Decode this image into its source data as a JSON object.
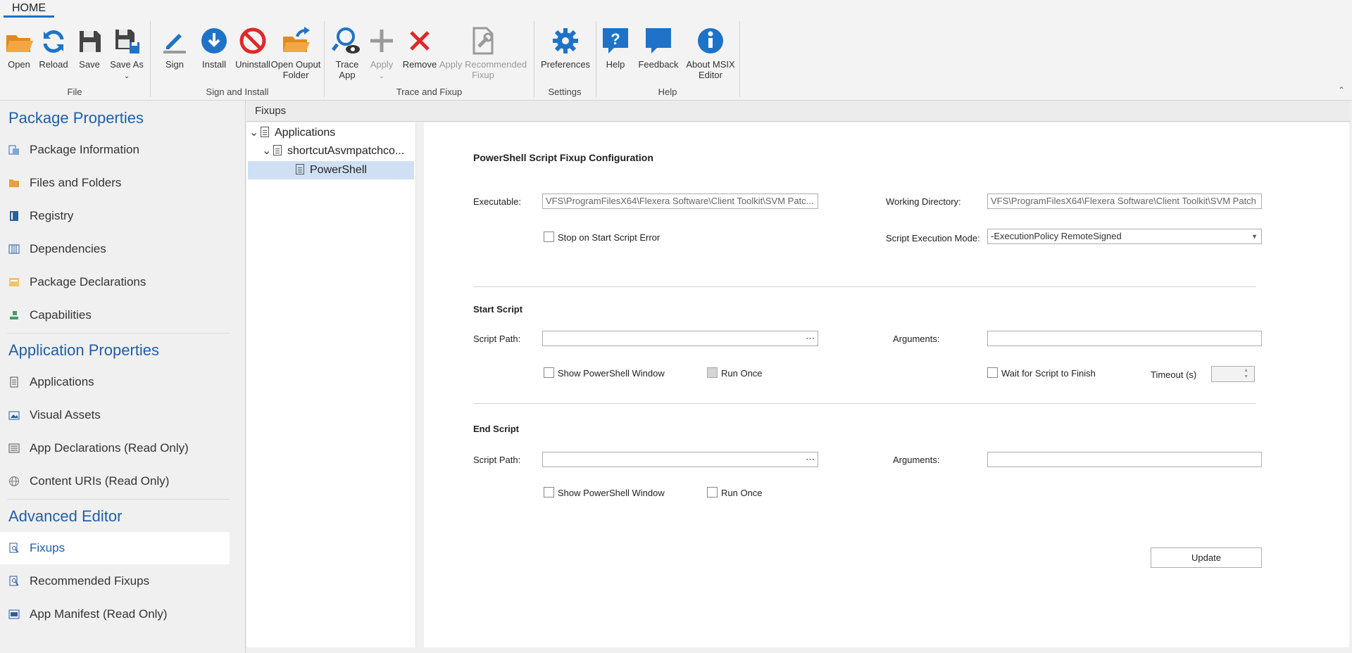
{
  "ribbon": {
    "tab": "HOME",
    "groups": {
      "file": "File",
      "sign": "Sign and Install",
      "trace": "Trace and Fixup",
      "settings": "Settings",
      "help": "Help"
    },
    "buttons": {
      "open": "Open",
      "reload": "Reload",
      "save": "Save",
      "save_as": "Save As",
      "sign": "Sign",
      "install": "Install",
      "uninstall": "Uninstall",
      "open_output_1": "Open Ouput",
      "open_output_2": "Folder",
      "trace_1": "Trace",
      "trace_2": "App",
      "apply": "Apply",
      "remove": "Remove",
      "apply_rec_1": "Apply Recommended",
      "apply_rec_2": "Fixup",
      "preferences": "Preferences",
      "help": "Help",
      "feedback": "Feedback",
      "about_1": "About MSIX",
      "about_2": "Editor"
    },
    "colors": {
      "accent": "#1e6fc0",
      "orange": "#f0962f",
      "red": "#e02828"
    }
  },
  "sidebar": {
    "sections": [
      "Package Properties",
      "Application Properties",
      "Advanced Editor"
    ],
    "items": [
      {
        "label": "Package Information",
        "icon": "package-info-icon"
      },
      {
        "label": "Files and Folders",
        "icon": "folder-icon"
      },
      {
        "label": "Registry",
        "icon": "registry-icon"
      },
      {
        "label": "Dependencies",
        "icon": "dependencies-icon"
      },
      {
        "label": "Package Declarations",
        "icon": "declarations-icon"
      },
      {
        "label": "Capabilities",
        "icon": "capabilities-icon"
      },
      {
        "label": "Applications",
        "icon": "applications-icon"
      },
      {
        "label": "Visual Assets",
        "icon": "visual-assets-icon"
      },
      {
        "label": "App Declarations (Read Only)",
        "icon": "app-declarations-icon"
      },
      {
        "label": "Content URIs (Read Only)",
        "icon": "globe-icon"
      },
      {
        "label": "Fixups",
        "icon": "fixups-icon"
      },
      {
        "label": "Recommended Fixups",
        "icon": "recommended-fixups-icon"
      },
      {
        "label": "App Manifest (Read Only)",
        "icon": "manifest-icon"
      }
    ]
  },
  "fixups": {
    "header": "Fixups",
    "tree": [
      "Applications",
      "shortcutAsvmpatchco...",
      "PowerShell"
    ]
  },
  "config": {
    "title": "PowerShell Script Fixup Configuration",
    "executable_label": "Executable:",
    "executable_value": "VFS\\ProgramFilesX64\\Flexera Software\\Client Toolkit\\SVM Patc...",
    "working_dir_label": "Working Directory:",
    "working_dir_value": "VFS\\ProgramFilesX64\\Flexera Software\\Client Toolkit\\SVM Patch",
    "stop_on_error": "Stop on Start Script Error",
    "exec_mode_label": "Script Execution Mode:",
    "exec_mode_value": "-ExecutionPolicy RemoteSigned",
    "start_script": "Start Script",
    "end_script": "End Script",
    "script_path_label": "Script Path:",
    "arguments_label": "Arguments:",
    "show_window": "Show PowerShell Window",
    "run_once": "Run Once",
    "wait_finish": "Wait for Script to Finish",
    "timeout_label": "Timeout (s)",
    "browse": "⋯",
    "update": "Update"
  }
}
